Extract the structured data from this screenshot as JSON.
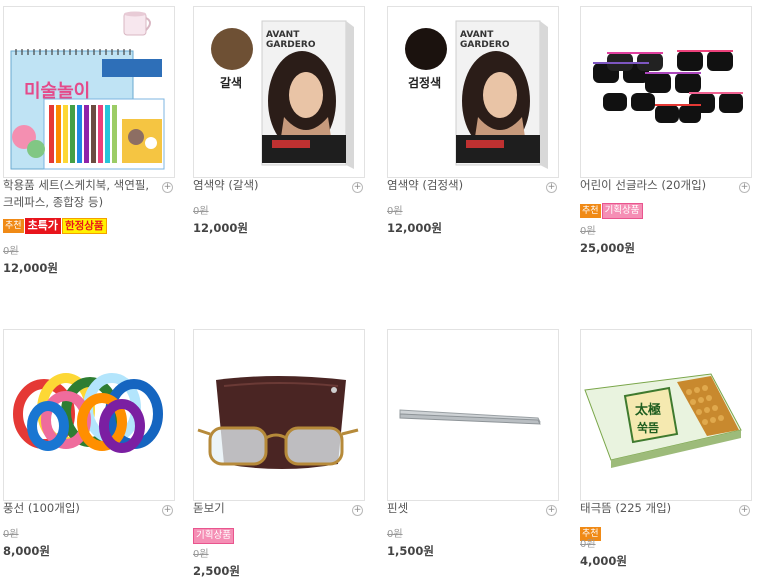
{
  "products": [
    {
      "name": "학용품 세트(스케치북, 색연필, 크레파스, 종합장 등)",
      "badges": [
        "추천",
        "초특가",
        "한정상품"
      ],
      "orig": "0원",
      "price": "12,000원",
      "thumb": "school-supplies-set-image"
    },
    {
      "name": "염색약 (갈색)",
      "badges": [],
      "orig": "0원",
      "price": "12,000원",
      "thumb": "hair-dye-brown-box",
      "swatch_label": "갈색",
      "swatch_color": "#6e5034",
      "box_brand": "AVANT GARDERO"
    },
    {
      "name": "염색약 (검정색)",
      "badges": [],
      "orig": "0원",
      "price": "12,000원",
      "thumb": "hair-dye-black-box",
      "swatch_label": "검정색",
      "swatch_color": "#1b120e",
      "box_brand": "AVANT GARDERO"
    },
    {
      "name": "어린이 선글라스 (20개입)",
      "badges": [
        "추천",
        "기획상품"
      ],
      "orig": "0원",
      "price": "25,000원",
      "thumb": "kids-sunglasses-image"
    },
    {
      "name": "풍선 (100개입)",
      "badges": [],
      "orig": "0원",
      "price": "8,000원",
      "thumb": "balloons-image"
    },
    {
      "name": "돋보기",
      "badges": [
        "기획상품"
      ],
      "orig": "0원",
      "price": "2,500원",
      "thumb": "reading-glasses-image"
    },
    {
      "name": "핀셋",
      "badges": [],
      "orig": "0원",
      "price": "1,500원",
      "thumb": "tweezers-image"
    },
    {
      "name": "태극뜸 (225 개입)",
      "badges": [
        "추천"
      ],
      "orig": "0원",
      "price": "4,000원",
      "thumb": "moxa-box-image",
      "box_text": "太極 쑥뜸"
    }
  ],
  "add_symbol": "+",
  "colors": {
    "border": "#e2e2e2",
    "text": "#555555",
    "recommend": "#f08a16",
    "special": "#e8141c",
    "limited_bg": "#fff200",
    "plan": "#f58fb5"
  }
}
